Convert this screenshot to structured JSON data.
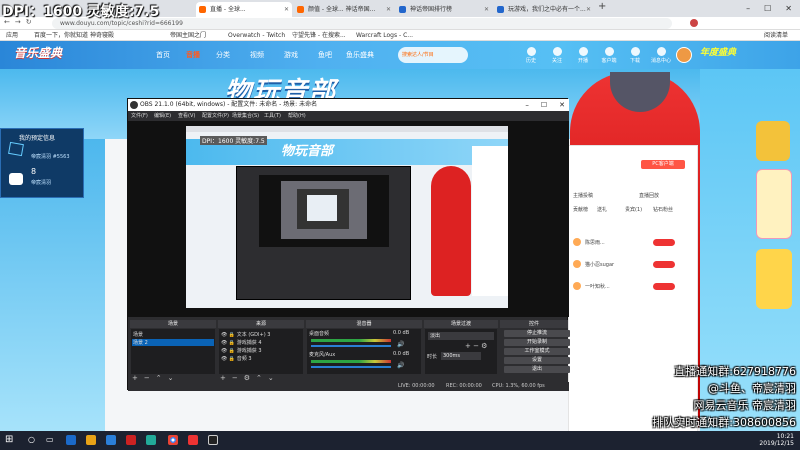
{
  "overlay": {
    "dpi": "DPI：1600 灵敏度:7.5",
    "live_group": "直播通知群:627918776",
    "douyu_handle": "@斗鱼、帝宸清羽",
    "netease": "网易云音乐 帝宸清羽",
    "queue_group": "排队实时通知群:308600856"
  },
  "browser": {
    "tabs": [
      {
        "title": "直播 - 全球..."
      },
      {
        "title": "颜值 - 全球... 神话帝国..."
      },
      {
        "title": "神话帝国排行榜"
      },
      {
        "title": "玩游戏，我们之中必有一个..."
      }
    ],
    "url": "www.douyu.com/topic/ceshi?rid=666199",
    "bookmarks": [
      "应用",
      "百度一下，你就知道",
      "神奇寝殿",
      "帝国主国之门",
      "Overwatch - Twitch",
      "守望先锋 - 在搜索...",
      "Warcraft Logs - C..."
    ],
    "reading_list": "阅读清单"
  },
  "douyu": {
    "logo": "音乐盛典",
    "nav": [
      "首页",
      "音播",
      "分类",
      "视频",
      "游戏",
      "鱼吧",
      "鱼乐盛典"
    ],
    "active_nav": "音播",
    "search_hint": "搜索达人/节目",
    "header_icons": [
      "历史",
      "关注",
      "开播",
      "客户端",
      "下载",
      "消息中心"
    ],
    "annual": "年度盛典",
    "banner": "物玩音部",
    "left_panel": {
      "title": "我的预定信息",
      "line1": "帝宸清羽 #5563",
      "line2": "8",
      "line3": "帝宸清羽"
    },
    "right_panel": {
      "btn": "PC客户端",
      "tabs": [
        "主播投稿",
        "直播回放"
      ],
      "sub": [
        "贡献榜",
        "送礼",
        "贵宾(1)",
        "钻石粉丝"
      ],
      "rows": [
        "陈思雨...",
        "猫小忍sugar",
        "一叶知秋..."
      ]
    }
  },
  "obs": {
    "title": "OBS 21.1.0 (64bit, windows) - 配置文件: 未命名 - 场景: 未命名",
    "menu": [
      "文件(F)",
      "编辑(E)",
      "查看(V)",
      "配置文件(P)",
      "场景集合(S)",
      "工具(T)",
      "帮助(H)"
    ],
    "preview_label": "DPI：1600 灵敏度:7.5",
    "docks": {
      "scenes": {
        "title": "场景",
        "items": [
          "场景",
          "场景 2"
        ]
      },
      "sources": {
        "title": "来源",
        "items": [
          "文本 (GDI+) 3",
          "游戏捕获 4",
          "游戏捕获 3",
          "音频 3"
        ]
      },
      "mixer": {
        "title": "混音器",
        "items": [
          "桌面音频",
          "麦克风/Aux"
        ],
        "levels": [
          "0.0 dB",
          "0.0 dB"
        ]
      },
      "transitions": {
        "title": "场景过渡",
        "type": "淡出",
        "duration_label": "时长",
        "duration": "300ms"
      },
      "controls": {
        "title": "控件",
        "buttons": [
          "停止推流",
          "开始录制",
          "工作室模式",
          "设置",
          "退出"
        ]
      }
    },
    "status": {
      "live": "LIVE: 00:00:00",
      "rec": "REC: 00:00:00",
      "cpu": "CPU: 1.3%, 60.00 fps"
    }
  },
  "taskbar": {
    "time": "10:21",
    "date": "2019/12/15"
  }
}
